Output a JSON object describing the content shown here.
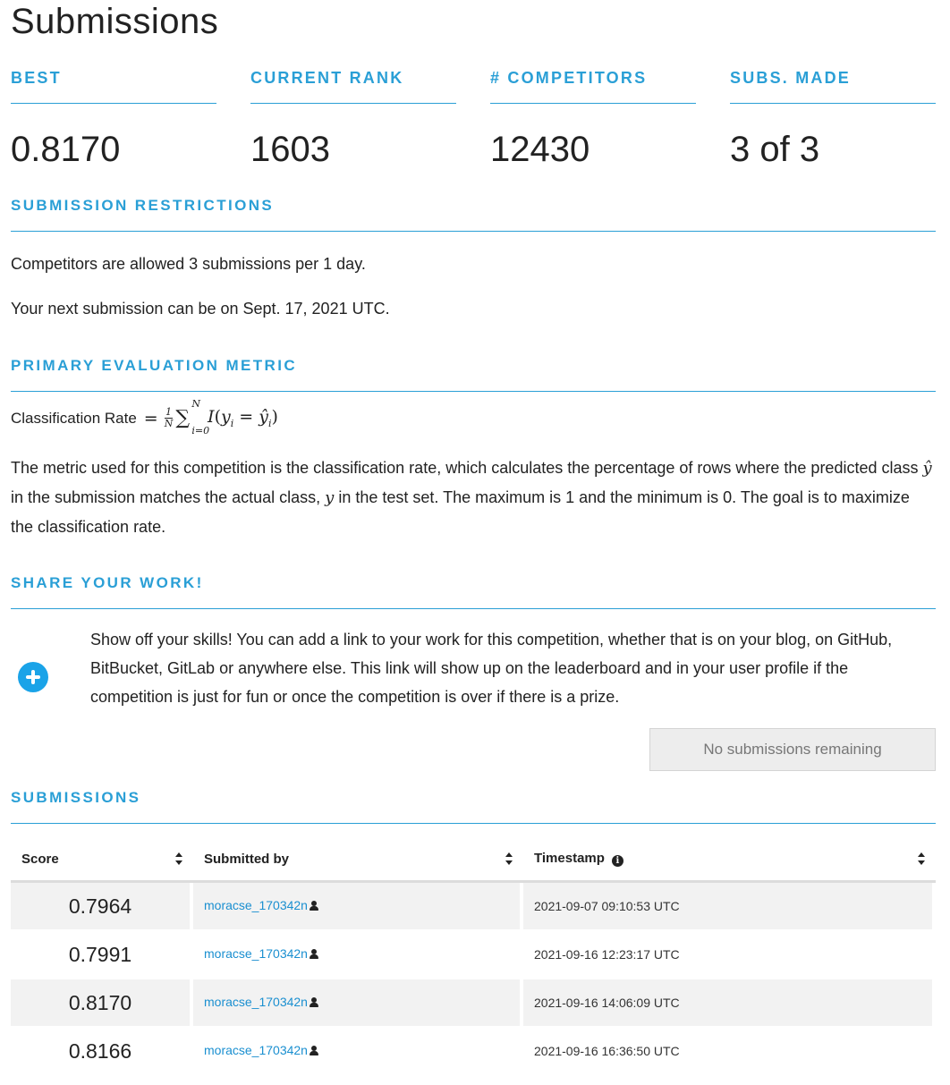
{
  "page": {
    "title": "Submissions"
  },
  "stats": [
    {
      "label": "BEST",
      "value": "0.8170"
    },
    {
      "label": "CURRENT RANK",
      "value": "1603"
    },
    {
      "label": "# COMPETITORS",
      "value": "12430"
    },
    {
      "label": "SUBS. MADE",
      "value": "3 of 3"
    }
  ],
  "restrictions": {
    "heading": "SUBMISSION RESTRICTIONS",
    "line1": "Competitors are allowed 3 submissions per 1 day.",
    "line2": "Your next submission can be on Sept. 17, 2021 UTC."
  },
  "metric": {
    "heading": "PRIMARY EVALUATION METRIC",
    "formula_label": "Classification Rate",
    "description_part1": "The metric used for this competition is the classification rate, which calculates the percentage of rows where the predicted class ",
    "description_part2": " in the submission matches the actual class, ",
    "description_part3": " in the test set. The maximum is 1 and the minimum is 0. The goal is to maximize the classification rate."
  },
  "share": {
    "heading": "SHARE YOUR WORK!",
    "text": "Show off your skills! You can add a link to your work for this competition, whether that is on your blog, on GitHub, BitBucket, GitLab or anywhere else. This link will show up on the leaderboard and in your user profile if the competition is just for fun or once the competition is over if there is a prize.",
    "button_label": "No submissions remaining"
  },
  "submissions": {
    "heading": "SUBMISSIONS",
    "columns": [
      "Score",
      "Submitted by",
      "Timestamp"
    ],
    "rows": [
      {
        "score": "0.7964",
        "user": "moracse_170342n",
        "timestamp": "2021-09-07 09:10:53 UTC"
      },
      {
        "score": "0.7991",
        "user": "moracse_170342n",
        "timestamp": "2021-09-16 12:23:17 UTC"
      },
      {
        "score": "0.8170",
        "user": "moracse_170342n",
        "timestamp": "2021-09-16 14:06:09 UTC"
      },
      {
        "score": "0.8166",
        "user": "moracse_170342n",
        "timestamp": "2021-09-16 16:36:50 UTC"
      }
    ]
  },
  "colors": {
    "accent": "#2a9fd6",
    "link": "#1a8fd0",
    "row_shade": "#f2f2f2"
  }
}
